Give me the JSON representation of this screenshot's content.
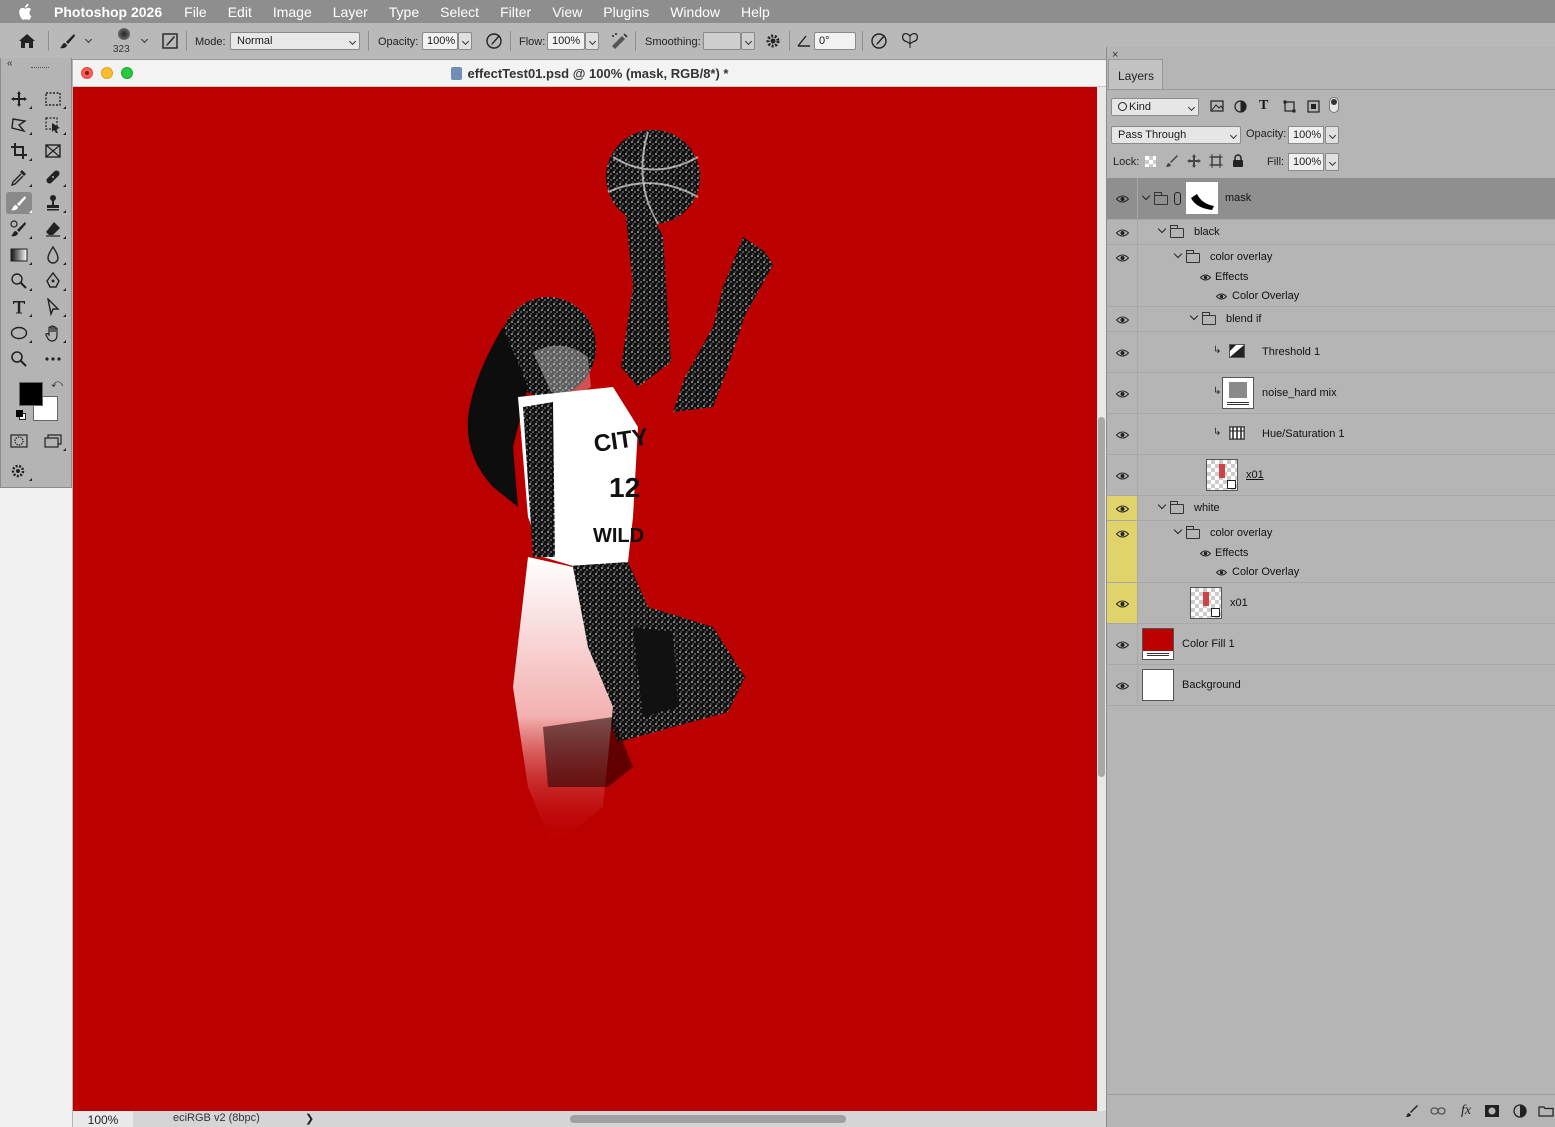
{
  "menubar": {
    "app_name": "Photoshop 2026",
    "items": [
      "File",
      "Edit",
      "Image",
      "Layer",
      "Type",
      "Select",
      "Filter",
      "View",
      "Plugins",
      "Window",
      "Help"
    ]
  },
  "options_bar": {
    "brush_size": "323",
    "mode_label": "Mode:",
    "mode_value": "Normal",
    "opacity_label": "Opacity:",
    "opacity_value": "100%",
    "flow_label": "Flow:",
    "flow_value": "100%",
    "smoothing_label": "Smoothing:",
    "smoothing_value": "",
    "angle_value": "0°"
  },
  "document": {
    "title": "effectTest01.psd @ 100% (mask, RGB/8*) *",
    "canvas_color": "#bb0000",
    "zoom": "100%",
    "color_profile": "eciRGB v2 (8bpc)",
    "status_arrow": "❯"
  },
  "colors": {
    "foreground": "#000000",
    "background": "#ffffff",
    "accent_yellow": "#dfd36a"
  },
  "layers_panel": {
    "tab_label": "Layers",
    "close_label": "×",
    "filter_kind": "Kind",
    "blend_mode": "Pass Through",
    "opacity_label": "Opacity:",
    "opacity_value": "100%",
    "lock_label": "Lock:",
    "fill_label": "Fill:",
    "fill_value": "100%",
    "layers": [
      {
        "name": "mask",
        "type": "group-with-mask",
        "selected": true
      },
      {
        "name": "black",
        "type": "group"
      },
      {
        "name": "color overlay",
        "type": "group"
      },
      {
        "name": "Effects",
        "type": "effects-header"
      },
      {
        "name": "Color Overlay",
        "type": "effect"
      },
      {
        "name": "blend if",
        "type": "group"
      },
      {
        "name": "Threshold 1",
        "type": "adjustment"
      },
      {
        "name": "noise_hard mix",
        "type": "layer"
      },
      {
        "name": "Hue/Saturation 1",
        "type": "adjustment"
      },
      {
        "name": "x01",
        "type": "smart-object"
      },
      {
        "name": "white",
        "type": "group"
      },
      {
        "name": "color overlay",
        "type": "group"
      },
      {
        "name": "Effects",
        "type": "effects-header"
      },
      {
        "name": "Color Overlay",
        "type": "effect"
      },
      {
        "name": "x01",
        "type": "smart-object"
      },
      {
        "name": "Color Fill 1",
        "type": "fill"
      },
      {
        "name": "Background",
        "type": "background"
      }
    ]
  }
}
